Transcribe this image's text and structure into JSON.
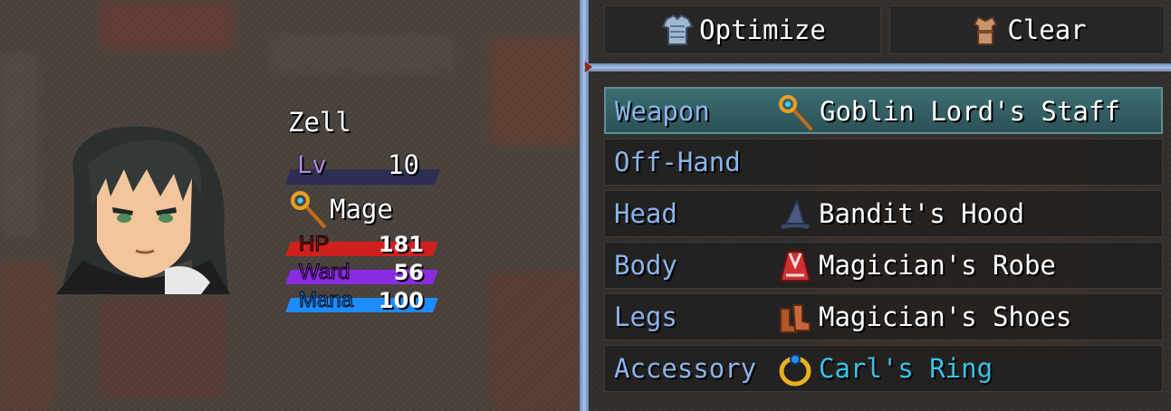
{
  "actor": {
    "name": "Zell",
    "level_label": "Lv",
    "level": "10",
    "class_icon": "staff-icon",
    "class_name": "Mage",
    "gauges": [
      {
        "label": "HP",
        "value": "181",
        "fill": 1.0,
        "color": "#d0201e",
        "label_color": "#a40d0d"
      },
      {
        "label": "Ward",
        "value": "56",
        "fill": 1.0,
        "color": "#8a2be2",
        "label_color": "#8a2be2"
      },
      {
        "label": "Mana",
        "value": "100",
        "fill": 1.0,
        "color": "#1e8cff",
        "label_color": "#1e8cff"
      }
    ]
  },
  "commands": {
    "optimize_label": "Optimize",
    "optimize_icon": "armor-icon",
    "clear_label": "Clear",
    "clear_icon": "tunic-icon"
  },
  "equipment": [
    {
      "slot": "Weapon",
      "icon": "staff-icon",
      "item": "Goblin Lord's Staff",
      "selected": true
    },
    {
      "slot": "Off-Hand",
      "icon": "",
      "item": ""
    },
    {
      "slot": "Head",
      "icon": "wizard-hat-icon",
      "item": "Bandit's Hood"
    },
    {
      "slot": "Body",
      "icon": "robe-icon",
      "item": "Magician's Robe"
    },
    {
      "slot": "Legs",
      "icon": "boots-icon",
      "item": "Magician's Shoes"
    },
    {
      "slot": "Accessory",
      "icon": "ring-icon",
      "item": "Carl's Ring",
      "special": true
    }
  ],
  "colors": {
    "slot_label": "#8ab4ea",
    "special_item": "#39c2e8",
    "selected_row": "#3d6e72",
    "divider": "#a9c2e8"
  }
}
